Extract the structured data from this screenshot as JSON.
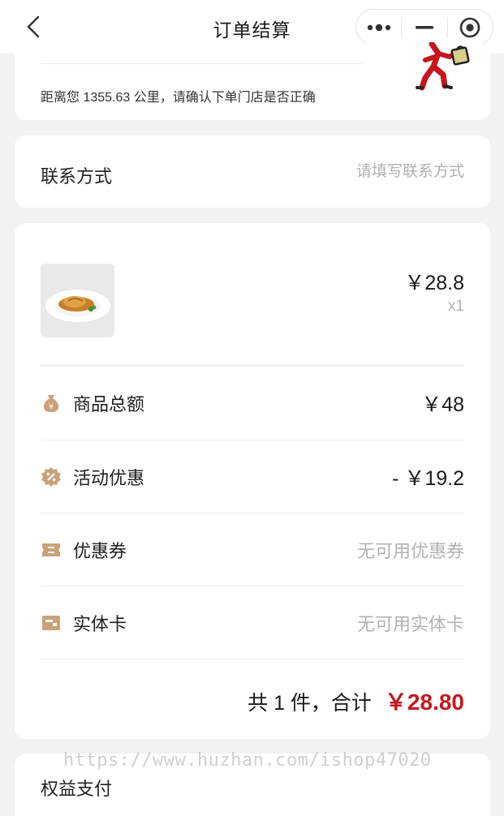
{
  "navbar": {
    "title": "订单结算"
  },
  "store": {
    "distance_text": "距离您 1355.63 公里，请确认下单门店是否正确"
  },
  "contact": {
    "label": "联系方式",
    "placeholder": "请填写联系方式"
  },
  "product": {
    "name": "",
    "price": "￥28.8",
    "quantity": "x1"
  },
  "summary": {
    "rows": [
      {
        "label": "商品总额",
        "value": "￥48",
        "icon": "money-bag-icon"
      },
      {
        "label": "活动优惠",
        "value": "- ￥19.2",
        "icon": "discount-icon"
      },
      {
        "label": "优惠券",
        "value": "无可用优惠券",
        "icon": "coupon-icon"
      },
      {
        "label": "实体卡",
        "value": "无可用实体卡",
        "icon": "card-icon"
      }
    ],
    "total_text": "共 1 件，合计",
    "total_amount": "￥28.80"
  },
  "benefit": {
    "label": "权益支付"
  },
  "watermark": "https://www.huzhan.com/ishop47020",
  "colors": {
    "accent": "#c8161e",
    "icon_brown": "#c9a27a",
    "background": "#f2f2f2"
  }
}
